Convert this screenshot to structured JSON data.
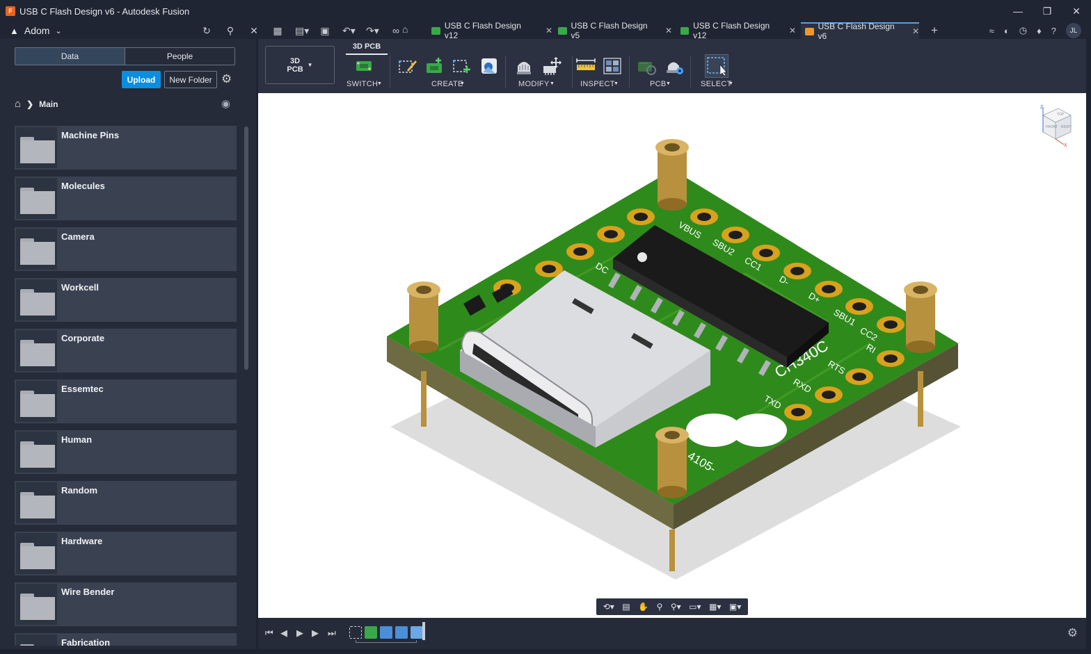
{
  "window": {
    "title": "USB C Flash Design v6 - Autodesk Fusion",
    "controls": [
      "minimize-icon",
      "restore-icon",
      "close-icon"
    ]
  },
  "topbar": {
    "team_name": "Adom",
    "quick_access_icons": [
      "refresh-icon",
      "search-icon",
      "close-icon",
      "grid-icon",
      "file-icon",
      "save-icon",
      "undo-icon",
      "redo-icon",
      "link-icon"
    ],
    "tabs": [
      {
        "label": "USB C Flash Design v12",
        "icon_color": "#3aa84a",
        "active": false
      },
      {
        "label": "USB C Flash Design v5",
        "icon_color": "#3aa84a",
        "active": false
      },
      {
        "label": "USB C Flash Design v12",
        "icon_color": "#3aa84a",
        "active": false
      },
      {
        "label": "USB C Flash Design v6",
        "icon_color": "#f0982a",
        "active": true
      }
    ],
    "avatar_initials": "JL"
  },
  "data_panel": {
    "tabs": {
      "data": "Data",
      "people": "People"
    },
    "upload_label": "Upload",
    "new_folder_label": "New Folder",
    "breadcrumb": "Main",
    "folders": [
      {
        "name": "Machine Pins"
      },
      {
        "name": "Molecules"
      },
      {
        "name": "Camera"
      },
      {
        "name": "Workcell"
      },
      {
        "name": "Corporate"
      },
      {
        "name": "Essemtec"
      },
      {
        "name": "Human"
      },
      {
        "name": "Random"
      },
      {
        "name": "Hardware"
      },
      {
        "name": "Wire Bender"
      },
      {
        "name": "Fabrication"
      }
    ]
  },
  "ribbon": {
    "workspace_line1": "3D",
    "workspace_line2": "PCB",
    "active_tab": "3D PCB",
    "groups": {
      "switch": "SWITCH",
      "create": "CREATE",
      "modify": "MODIFY",
      "inspect": "INSPECT",
      "pcb": "PCB",
      "select": "SELECT"
    }
  },
  "viewport": {
    "silkscreen": {
      "chip": "CH340C",
      "pins_top": [
        "VBUS",
        "SBU2",
        "CC1",
        "D-",
        "D+",
        "SBU1",
        "CC2"
      ],
      "pins_right": [
        "RI",
        "RTS",
        "RXD",
        "TXD"
      ],
      "partial_left": "DC",
      "part_number": "4105-"
    },
    "viewcube": {
      "top": "TOP",
      "front": "FRONT",
      "right": "RIGHT",
      "axis_z": "Z",
      "axis_x": "X"
    },
    "board_color": "#2f8a1c",
    "pad_color": "#d8a21c"
  },
  "nav_bar": {
    "icons": [
      "orbit-icon",
      "look-at-icon",
      "pan-icon",
      "zoom-window-icon",
      "zoom-icon",
      "display-settings-icon",
      "grid-icon",
      "viewports-icon"
    ]
  },
  "timeline": {
    "controls": [
      "go-to-start-icon",
      "step-back-icon",
      "play-icon",
      "step-forward-icon",
      "go-to-end-icon"
    ],
    "features": [
      "sketch-feature",
      "pcb-feature",
      "image-feature",
      "image-feature",
      "insert-feature"
    ]
  },
  "colors": {
    "accent": "#0a8ee0",
    "panel_bg": "#252b38",
    "ribbon_bg": "#2b3140"
  }
}
